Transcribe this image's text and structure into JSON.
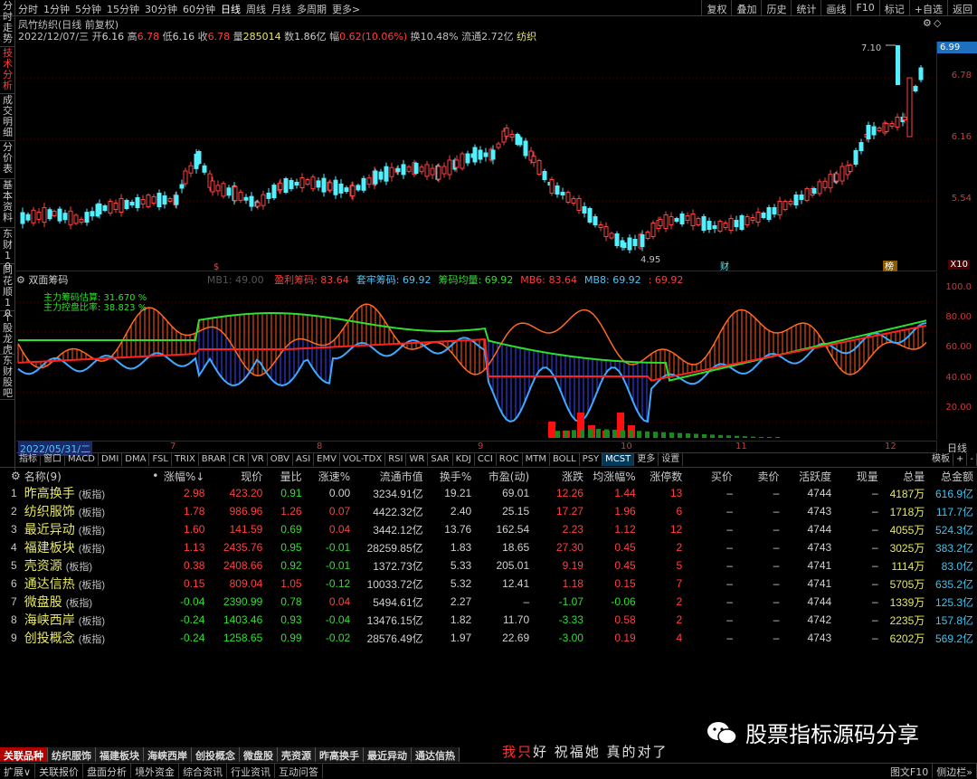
{
  "topbar": {
    "periods": [
      "分时",
      "1分钟",
      "5分钟",
      "15分钟",
      "30分钟",
      "60分钟",
      "日线",
      "周线",
      "月线",
      "多周期",
      "更多>"
    ],
    "active_period": "日线",
    "right_buttons": [
      "复权",
      "叠加",
      "历史",
      "统计",
      "画线",
      "F10",
      "标记",
      "+自选",
      "返回"
    ]
  },
  "leftnav": [
    "分时走势",
    "技术分析",
    "成交明细",
    "分价表",
    "基本资料",
    "东财10",
    "同花顺10",
    "个股龙虎",
    "东财股吧"
  ],
  "stock": {
    "title": "凤竹纺织(日线 前复权)",
    "date": "2022/12/07/三",
    "open_label": "开",
    "open": "6.16",
    "high_label": "高",
    "high": "6.78",
    "low_label": "低",
    "low": "6.16",
    "close_label": "收",
    "close": "6.78",
    "vol_label": "量",
    "vol": "285014",
    "amount_label": "数",
    "amount": "1.86亿",
    "chg_label": "幅",
    "chg": "0.62(10.06%)",
    "turnover": "换10.48%",
    "float": "流通2.72亿",
    "industry": "纺织"
  },
  "kaxis": {
    "labels": [
      "6.78",
      "6.16",
      "5.54",
      "4.95"
    ],
    "current": "6.99",
    "x10": "X10"
  },
  "kmarks": {
    "high": "7.10",
    "low": "4.95",
    "m1": "$",
    "m2": "财",
    "m3": "榜"
  },
  "indicator": {
    "name": "双面筹码",
    "params": "MB1: 49.00",
    "items": [
      {
        "label": "盈利筹码: 83.64",
        "color": "#ff3c3c"
      },
      {
        "label": "套牢筹码: 69.92",
        "color": "#4fc3f7"
      },
      {
        "label": "筹码均量: 69.92",
        "color": "#2ee02e"
      },
      {
        "label": "MB6: 83.64",
        "color": "#ff3c3c"
      },
      {
        "label": "MB8: 69.92",
        "color": "#4fc3f7"
      },
      {
        "label": ": 69.92",
        "color": "#ff3c3c"
      }
    ],
    "legend1": "主力筹码估算: 31.670 %",
    "legend2": "主力控盘比率: 38.823 %",
    "axis": [
      "100.0",
      "80.00",
      "60.00",
      "40.00",
      "20.00"
    ]
  },
  "dateaxis": {
    "start": "2022/05/31/二",
    "ticks": [
      "7",
      "8",
      "9",
      "10",
      "11",
      "12"
    ],
    "day": "日线"
  },
  "indtabs": [
    "指标",
    "窗口",
    "MACD",
    "DMI",
    "DMA",
    "FSL",
    "TRIX",
    "BRAR",
    "CR",
    "VR",
    "OBV",
    "ASI",
    "EMV",
    "VOL-TDX",
    "RSI",
    "WR",
    "SAR",
    "KDJ",
    "CCI",
    "ROC",
    "MTM",
    "BOLL",
    "PSY",
    "MCST",
    "更多",
    "设置"
  ],
  "indtabs_right": [
    "模板",
    "+",
    "-"
  ],
  "table": {
    "headers": [
      "",
      "名称(9)",
      "•",
      "涨幅%↓",
      "现价",
      "量比",
      "涨速%",
      "流通市值",
      "换手%",
      "市盈(动)",
      "涨跌",
      "均涨幅%",
      "涨停数",
      "买价",
      "卖价",
      "活跃度",
      "现量",
      "总量",
      "总金额"
    ],
    "rows": [
      [
        "1",
        "昨高换手",
        "(板指)",
        "2.98",
        "423.20",
        "0.91",
        "0.00",
        "3234.91亿",
        "19.21",
        "69.01",
        "12.26",
        "1.44",
        "13",
        "–",
        "–",
        "4744",
        "–",
        "4187万",
        "616.9亿"
      ],
      [
        "2",
        "纺织服饰",
        "(板指)",
        "1.78",
        "986.96",
        "1.26",
        "0.07",
        "4422.32亿",
        "2.40",
        "25.15",
        "17.27",
        "1.96",
        "6",
        "–",
        "–",
        "4743",
        "–",
        "1718万",
        "117.7亿"
      ],
      [
        "3",
        "最近异动",
        "(板指)",
        "1.60",
        "141.59",
        "0.69",
        "0.04",
        "3442.12亿",
        "13.76",
        "162.54",
        "2.23",
        "1.12",
        "12",
        "–",
        "–",
        "4744",
        "–",
        "4055万",
        "524.3亿"
      ],
      [
        "4",
        "福建板块",
        "(板指)",
        "1.13",
        "2435.76",
        "0.95",
        "-0.01",
        "28259.85亿",
        "1.83",
        "18.65",
        "27.30",
        "0.45",
        "2",
        "–",
        "–",
        "4743",
        "–",
        "3025万",
        "383.2亿"
      ],
      [
        "5",
        "壳资源",
        "(板指)",
        "0.38",
        "2408.66",
        "0.92",
        "-0.01",
        "1372.73亿",
        "5.33",
        "205.01",
        "9.19",
        "0.45",
        "5",
        "–",
        "–",
        "4741",
        "–",
        "1114万",
        "83.0亿"
      ],
      [
        "6",
        "通达信热",
        "(板指)",
        "0.15",
        "809.04",
        "1.05",
        "-0.12",
        "10033.72亿",
        "5.32",
        "12.41",
        "1.18",
        "0.15",
        "7",
        "–",
        "–",
        "4741",
        "–",
        "5705万",
        "635.2亿"
      ],
      [
        "7",
        "微盘股",
        "(板指)",
        "-0.04",
        "2390.99",
        "0.78",
        "0.04",
        "5494.61亿",
        "2.27",
        "–",
        "-1.07",
        "-0.06",
        "2",
        "–",
        "–",
        "4744",
        "–",
        "1339万",
        "125.3亿"
      ],
      [
        "8",
        "海峡西岸",
        "(板指)",
        "-0.24",
        "1403.46",
        "0.93",
        "-0.04",
        "13476.15亿",
        "1.82",
        "11.70",
        "-3.33",
        "0.58",
        "2",
        "–",
        "–",
        "4742",
        "–",
        "2235万",
        "157.8亿"
      ],
      [
        "9",
        "创投概念",
        "(板指)",
        "-0.24",
        "1258.65",
        "0.99",
        "-0.02",
        "28576.49亿",
        "1.97",
        "22.69",
        "-3.00",
        "0.19",
        "4",
        "–",
        "–",
        "4743",
        "–",
        "6202万",
        "569.2亿"
      ]
    ]
  },
  "bottomtabs": [
    "关联品种",
    "纺织服饰",
    "福建板块",
    "海峡西岸",
    "创投概念",
    "微盘股",
    "壳资源",
    "昨高换手",
    "最近异动",
    "通达信热"
  ],
  "marquee": {
    "red": "我只",
    "rest": "好 祝福她 真的对了"
  },
  "statusbar": [
    "扩展∨",
    "关联报价",
    "盘面分析",
    "境外资金",
    "综合资讯",
    "行业资讯",
    "互动问答"
  ],
  "statusbar_right": [
    "图文F10",
    "侧边栏»"
  ],
  "watermark": "股票指标源码分享",
  "colors": {
    "up": "#ff4040",
    "down": "#2ee02e",
    "cyan": "#3fc4f0",
    "yellow": "#e8e860"
  }
}
